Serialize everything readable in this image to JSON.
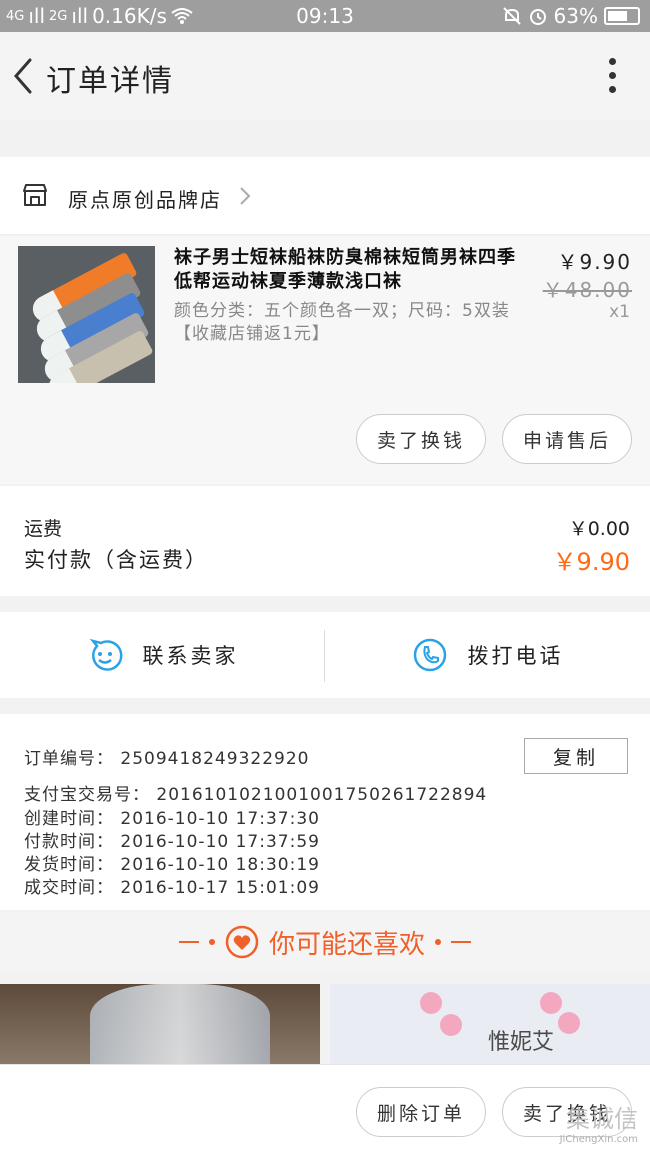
{
  "status_bar": {
    "signal_1": "4G",
    "signal_2": "2G",
    "speed": "0.16K/s",
    "time": "09:13",
    "battery": "63%"
  },
  "header": {
    "title": "订单详情"
  },
  "store": {
    "name": "原点原创品牌店"
  },
  "product": {
    "name": "袜子男士短袜船袜防臭棉袜短筒男袜四季低帮运动袜夏季薄款浅口袜",
    "spec": "颜色分类：五个颜色各一双；尺码：5双装【收藏店铺返1元】",
    "price": "￥9.90",
    "original_price": "￥48.00",
    "quantity": "x1",
    "buttons": {
      "exchange": "卖了换钱",
      "after_sale": "申请售后"
    }
  },
  "fees": {
    "shipping_label": "运费",
    "shipping_value": "￥0.00",
    "paid_label": "实付款（含运费）",
    "paid_value": "￥9.90"
  },
  "contact": {
    "seller": "联系卖家",
    "call": "拨打电话"
  },
  "order_info": {
    "order_no_label": "订单编号：",
    "order_no": "2509418249322920",
    "copy": "复制",
    "alipay_label": "支付宝交易号：",
    "alipay_no": "2016101021001001750261722894",
    "created_label": "创建时间：",
    "created": "2016-10-10 17:37:30",
    "paid_label": "付款时间：",
    "paid": "2016-10-10 17:37:59",
    "shipped_label": "发货时间：",
    "shipped": "2016-10-10 18:30:19",
    "done_label": "成交时间：",
    "done": "2016-10-17 15:01:09"
  },
  "recommend": {
    "title": "你可能还喜欢",
    "item2_brand": "惟妮艾"
  },
  "bottom": {
    "delete": "删除订单",
    "sell": "卖了换钱",
    "watermark": "集诚信",
    "watermark_url": "JiChengXin.com"
  },
  "colors": {
    "accent": "#ff6a13",
    "link_blue": "#2aa3e6",
    "status_bar": "#9e9e9e"
  },
  "icons": [
    "back-arrow-icon",
    "more-vertical-icon",
    "store-icon",
    "chevron-right-icon",
    "smile-chat-icon",
    "phone-icon",
    "heart-icon",
    "wifi-icon",
    "alarm-icon",
    "mute-icon"
  ]
}
